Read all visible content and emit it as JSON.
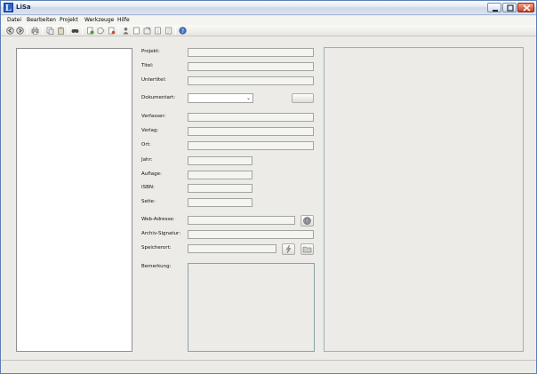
{
  "window": {
    "title": "LiSa",
    "icon_letter": "L"
  },
  "menu": [
    {
      "label": "Datei"
    },
    {
      "label": "Bearbeiten"
    },
    {
      "label": "Projekt"
    },
    {
      "label": "Werkzeuge"
    },
    {
      "label": "Hilfe"
    }
  ],
  "form": {
    "projekt": {
      "label": "Projekt:",
      "value": ""
    },
    "titel": {
      "label": "Titel:",
      "value": ""
    },
    "untertitel": {
      "label": "Untertitel:",
      "value": ""
    },
    "dokumentart": {
      "label": "Dokumentart:",
      "selected": ""
    },
    "verfasser": {
      "label": "Verfasser:",
      "value": ""
    },
    "verlag": {
      "label": "Verlag:",
      "value": ""
    },
    "ort": {
      "label": "Ort:",
      "value": ""
    },
    "jahr": {
      "label": "Jahr:",
      "value": ""
    },
    "auflage": {
      "label": "Auflage:",
      "value": ""
    },
    "isbn": {
      "label": "ISBN:",
      "value": ""
    },
    "seite": {
      "label": "Seite:",
      "value": ""
    },
    "webadresse": {
      "label": "Web-Adresse:",
      "value": ""
    },
    "archiv": {
      "label": "Archiv-Signatur:",
      "value": ""
    },
    "speicherort": {
      "label": "Speicherort:",
      "value": ""
    },
    "bemerkung": {
      "label": "Bemerkung:",
      "value": ""
    }
  },
  "icons": {
    "toolbar": [
      "back-icon",
      "forward-icon",
      "print-icon",
      "copy-icon",
      "paste-icon",
      "search-icon",
      "new-entry-icon",
      "tag-icon",
      "bookmark-icon",
      "user-icon",
      "page-icon",
      "export-icon",
      "import-icon",
      "document-icon",
      "help-icon"
    ],
    "accent": "#2c63c6"
  }
}
